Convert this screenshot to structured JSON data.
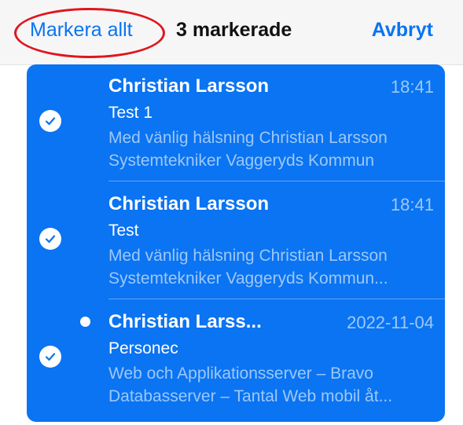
{
  "header": {
    "select_all": "Markera allt",
    "title": "3 markerade",
    "cancel": "Avbryt"
  },
  "colors": {
    "accent": "#0a74f2",
    "annotation": "#e0161c",
    "background": "#ffffff"
  },
  "icons": {
    "check": "checkmark-circle-icon",
    "unread": "unread-dot-icon"
  },
  "messages": [
    {
      "sender": "Christian Larsson",
      "time": "18:41",
      "subject": "Test 1",
      "preview_line1": "Med vänlig hälsning Christian Larsson",
      "preview_line2": "Systemtekniker Vaggeryds Kommun",
      "selected": true,
      "unread": false
    },
    {
      "sender": "Christian Larsson",
      "time": "18:41",
      "subject": "Test",
      "preview_line1": "Med vänlig hälsning Christian Larsson",
      "preview_line2": "Systemtekniker Vaggeryds Kommun...",
      "selected": true,
      "unread": false
    },
    {
      "sender": "Christian Larss...",
      "time": "2022-11-04",
      "subject": "Personec",
      "preview_line1": "Web och Applikationsserver – Bravo",
      "preview_line2": "Databasserver – Tantal Web mobil åt...",
      "selected": true,
      "unread": true
    }
  ]
}
